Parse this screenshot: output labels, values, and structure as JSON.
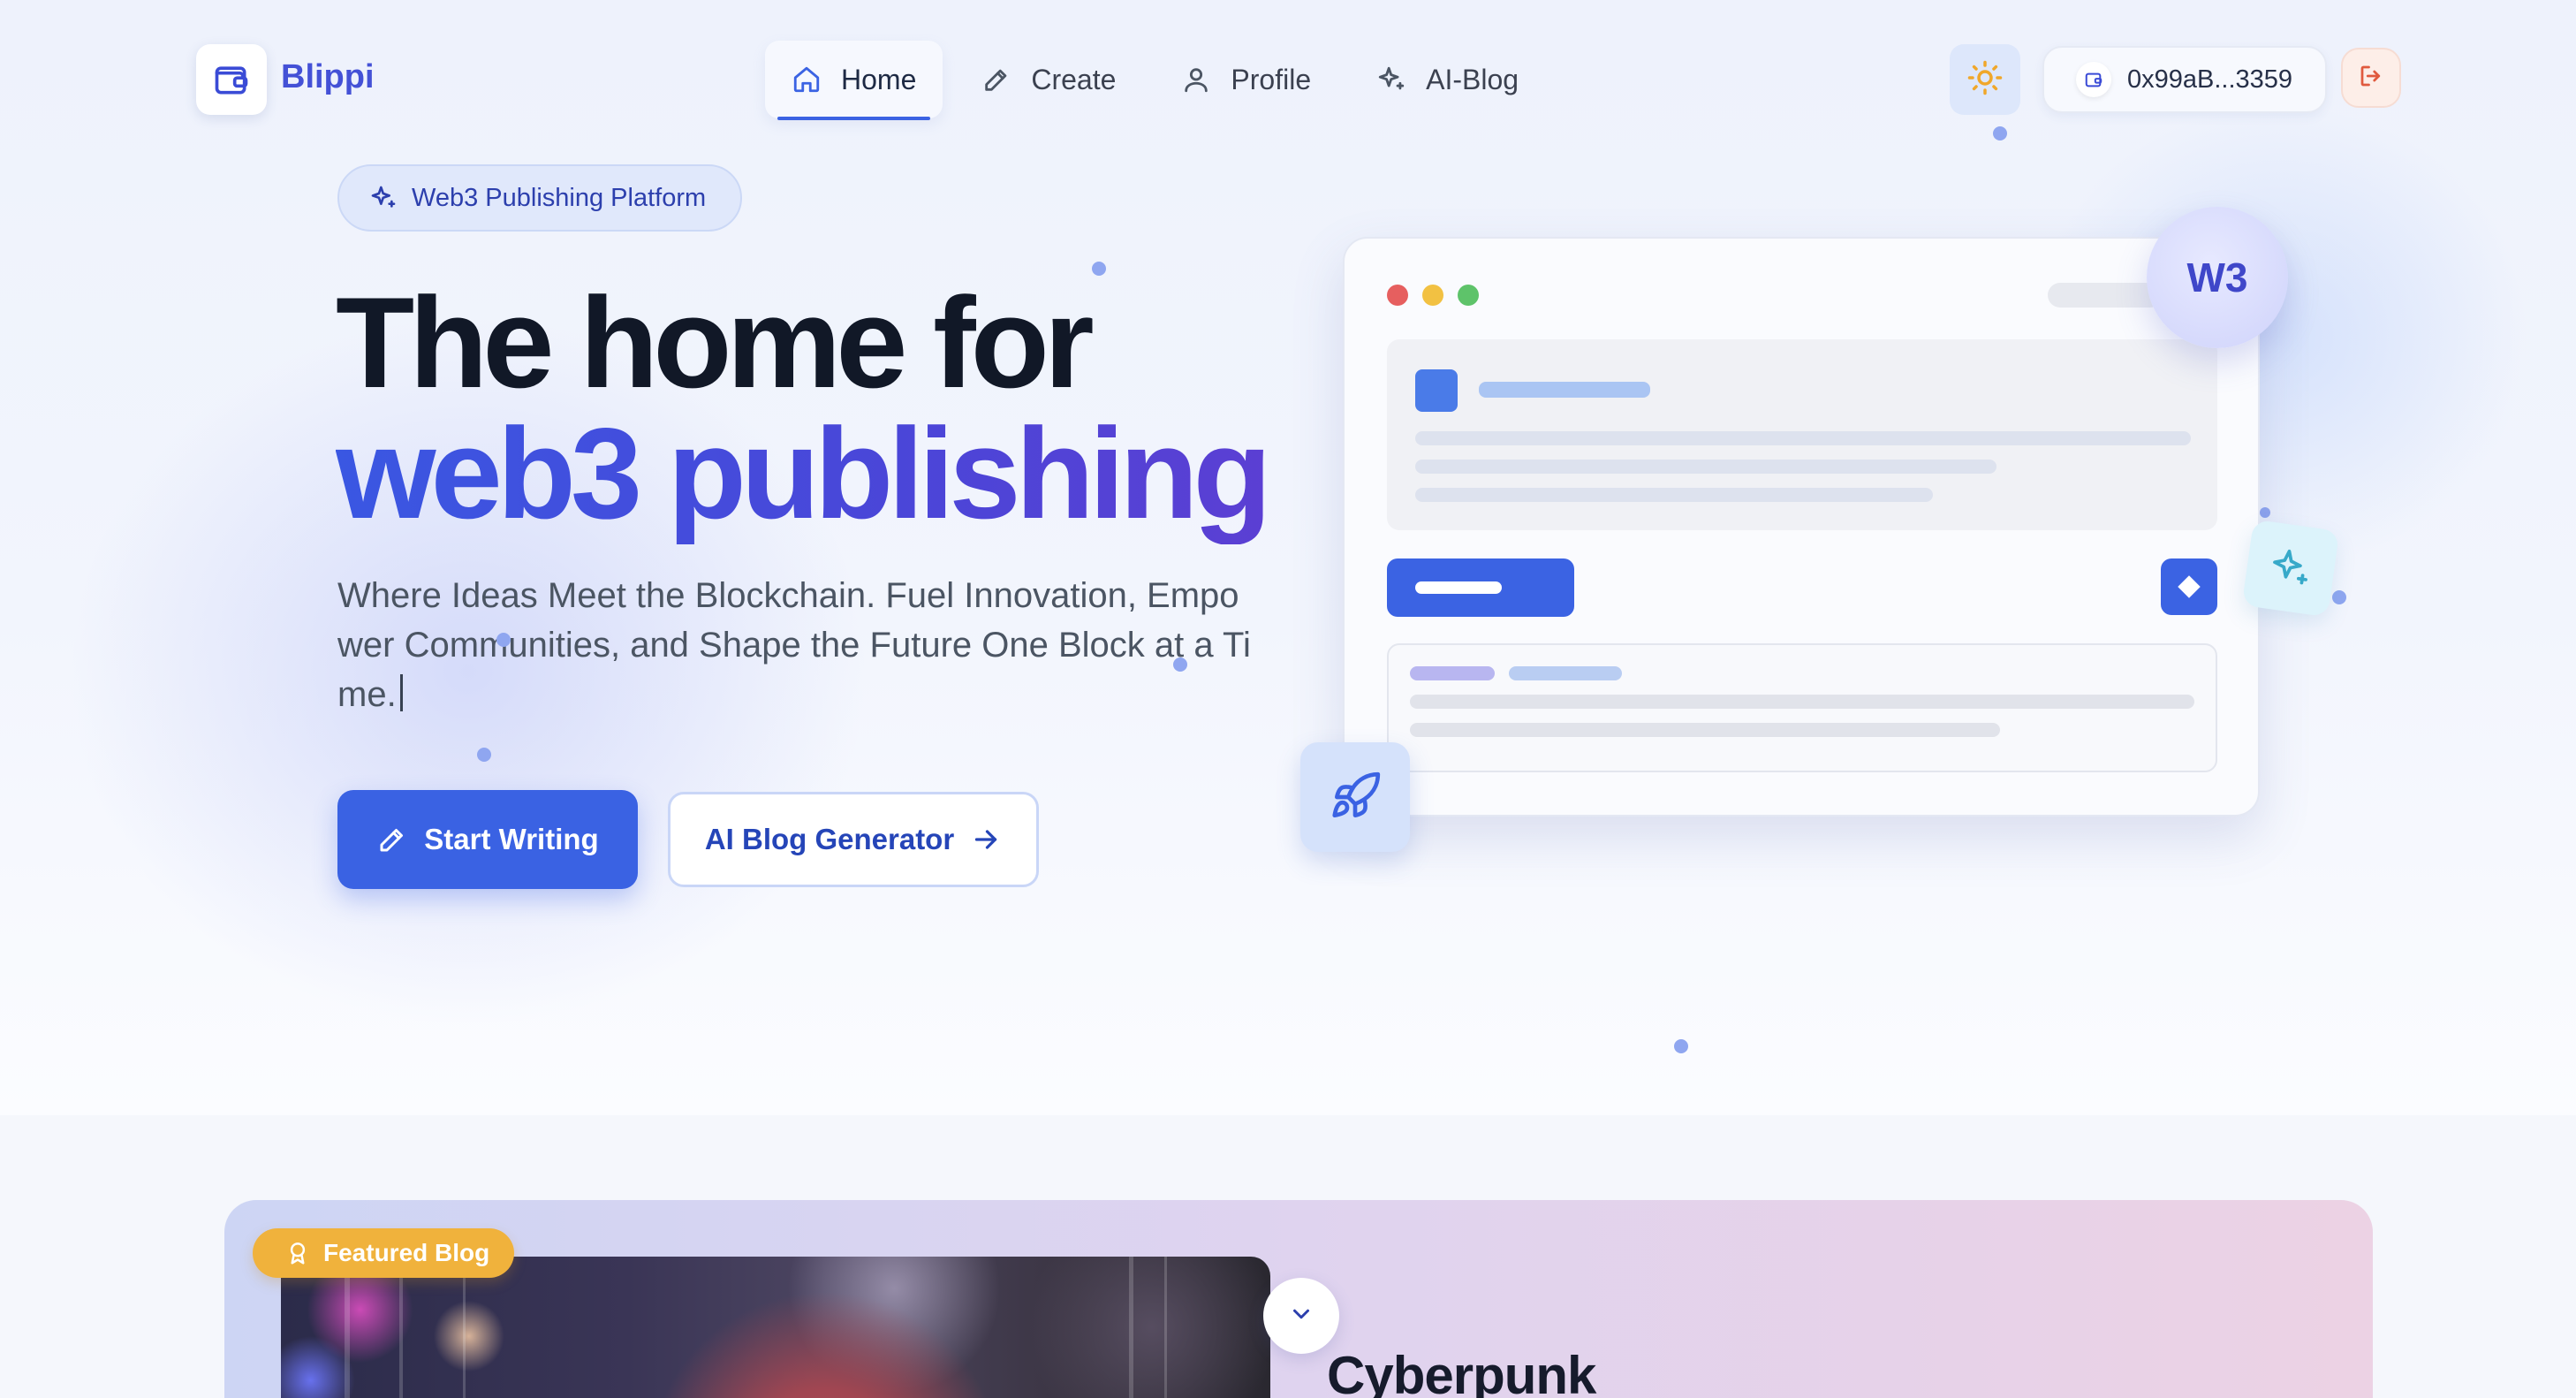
{
  "brand": {
    "name": "Blippi",
    "accent": "#3a62e3"
  },
  "nav": {
    "items": [
      {
        "label": "Home",
        "icon": "home-icon",
        "active": true
      },
      {
        "label": "Create",
        "icon": "pencil-icon",
        "active": false
      },
      {
        "label": "Profile",
        "icon": "user-icon",
        "active": false
      },
      {
        "label": "AI-Blog",
        "icon": "sparkles-icon",
        "active": false
      }
    ]
  },
  "header": {
    "theme_icon": "sun-icon",
    "wallet_address": "0x99aB...3359",
    "logout_icon": "logout-icon"
  },
  "hero": {
    "badge": "Web3 Publishing Platform",
    "title_line1": "The home for",
    "title_line2": "web3 publishing",
    "subtitle": "Where Ideas Meet the Blockchain. Fuel Innovation, Empower Communities, and Shape the Future One Block at a Time.",
    "primary_cta": "Start Writing",
    "secondary_cta": "AI Blog Generator",
    "mock_badge": "W3"
  },
  "featured": {
    "badge": "Featured Blog",
    "title": "Cyberpunk"
  }
}
